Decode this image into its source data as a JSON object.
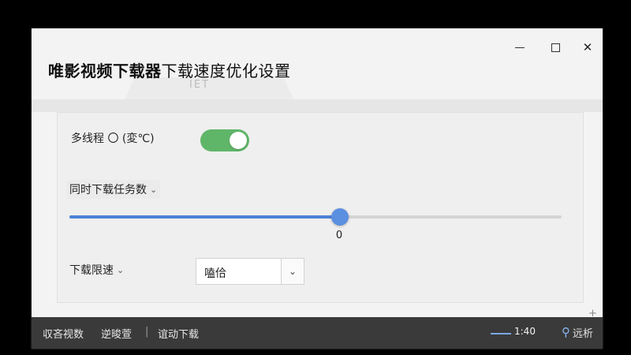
{
  "window": {
    "title_bold": "唯影视频下载器",
    "title_rest": "下载速度优化设置",
    "tab_label": "IET"
  },
  "controls": {
    "min_icon": "minimize-icon",
    "max_icon": "maximize-icon",
    "close_icon": "close-icon",
    "close_glyph": "✕"
  },
  "settings": {
    "multithread_label": "多线程 〇 (変℃)",
    "multithread_enabled": true,
    "concurrent_label": "同时下载任务数",
    "concurrent_value": "0",
    "concurrent_fraction": 0.55,
    "speed_limit_label": "下载限速",
    "speed_limit_value": "嗑佮",
    "chevron_glyph": "⌄",
    "select_chevron_glyph": "⌄"
  },
  "corner": {
    "plus": "+"
  },
  "statusbar": {
    "item1": "収吝视数",
    "item2": "逆晙萱",
    "separator": "|",
    "item3": "谊动下载",
    "zoom": "1:40",
    "search_label": "远析",
    "search_icon_glyph": "⚲"
  },
  "colors": {
    "toggle_on": "#5fb668",
    "slider_accent": "#4d82d6",
    "statusbar_bg": "#3a3a3a"
  }
}
